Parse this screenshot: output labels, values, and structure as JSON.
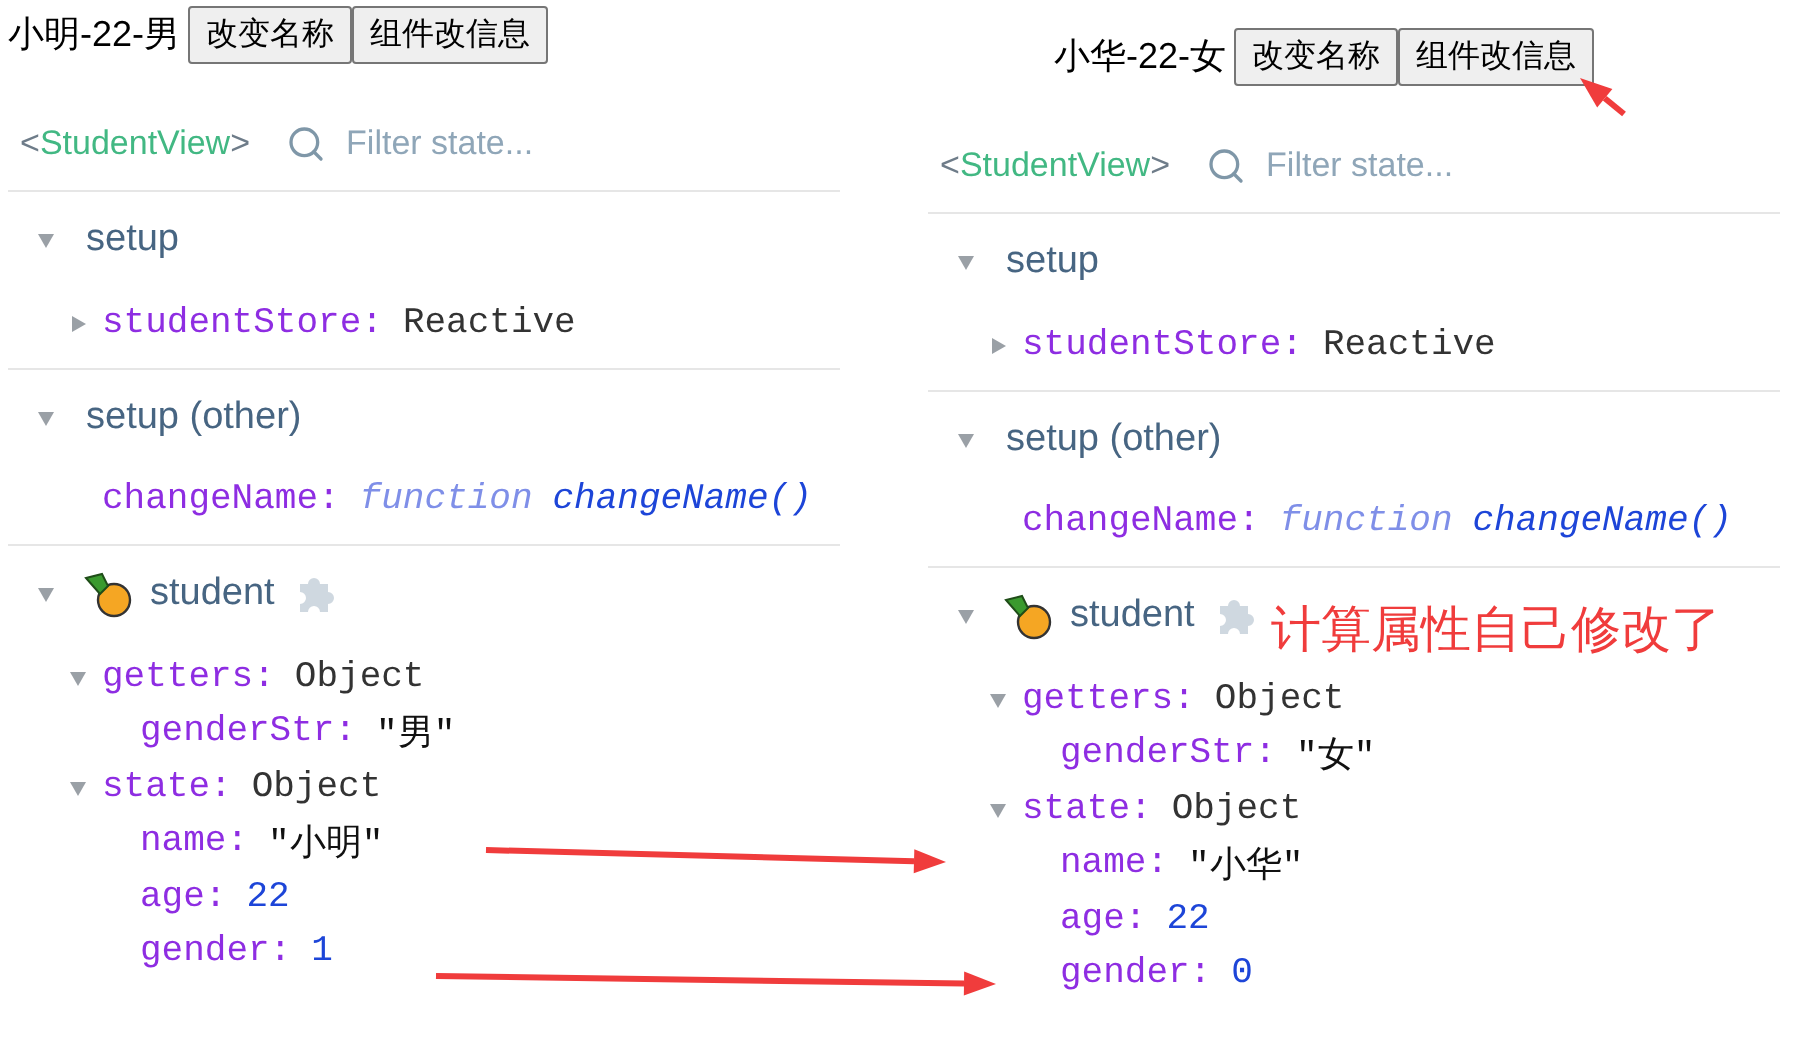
{
  "panels": [
    {
      "heading": "小明-22-男",
      "buttons": [
        "改变名称",
        "组件改信息"
      ],
      "component": {
        "open": "<",
        "name": "StudentView",
        "close": ">"
      },
      "filter": {
        "placeholder": "Filter state..."
      },
      "sections": [
        {
          "title": "setup",
          "kind": "plain",
          "expanded": true,
          "items": [
            {
              "key": "studentStore:",
              "kind": "object",
              "value": "Reactive",
              "expanded": false
            }
          ]
        },
        {
          "title": "setup (other)",
          "kind": "plain",
          "expanded": true,
          "items": [
            {
              "key": "changeName:",
              "kind": "function",
              "keyword": "function",
              "value": "changeName()"
            }
          ]
        },
        {
          "title": "student",
          "kind": "store",
          "expanded": true,
          "items": [
            {
              "key": "getters:",
              "kind": "object",
              "value": "Object",
              "expanded": true,
              "children": [
                {
                  "key": "genderStr:",
                  "kind": "string",
                  "value": "\"男\""
                }
              ]
            },
            {
              "key": "state:",
              "kind": "object",
              "value": "Object",
              "expanded": true,
              "children": [
                {
                  "key": "name:",
                  "kind": "string",
                  "value": "\"小明\""
                },
                {
                  "key": "age:",
                  "kind": "number",
                  "value": "22"
                },
                {
                  "key": "gender:",
                  "kind": "number",
                  "value": "1"
                }
              ]
            }
          ]
        }
      ]
    },
    {
      "heading": "小华-22-女",
      "buttons": [
        "改变名称",
        "组件改信息"
      ],
      "component": {
        "open": "<",
        "name": "StudentView",
        "close": ">"
      },
      "filter": {
        "placeholder": "Filter state..."
      },
      "sections": [
        {
          "title": "setup",
          "kind": "plain",
          "expanded": true,
          "items": [
            {
              "key": "studentStore:",
              "kind": "object",
              "value": "Reactive",
              "expanded": false
            }
          ]
        },
        {
          "title": "setup (other)",
          "kind": "plain",
          "expanded": true,
          "items": [
            {
              "key": "changeName:",
              "kind": "function",
              "keyword": "function",
              "value": "changeName()"
            }
          ]
        },
        {
          "title": "student",
          "kind": "store",
          "expanded": true,
          "note": "计算属性自己修改了",
          "items": [
            {
              "key": "getters:",
              "kind": "object",
              "value": "Object",
              "expanded": true,
              "children": [
                {
                  "key": "genderStr:",
                  "kind": "string",
                  "value": "\"女\""
                }
              ]
            },
            {
              "key": "state:",
              "kind": "object",
              "value": "Object",
              "expanded": true,
              "children": [
                {
                  "key": "name:",
                  "kind": "string",
                  "value": "\"小华\""
                },
                {
                  "key": "age:",
                  "kind": "number",
                  "value": "22"
                },
                {
                  "key": "gender:",
                  "kind": "number",
                  "value": "0"
                }
              ]
            }
          ]
        }
      ]
    }
  ]
}
